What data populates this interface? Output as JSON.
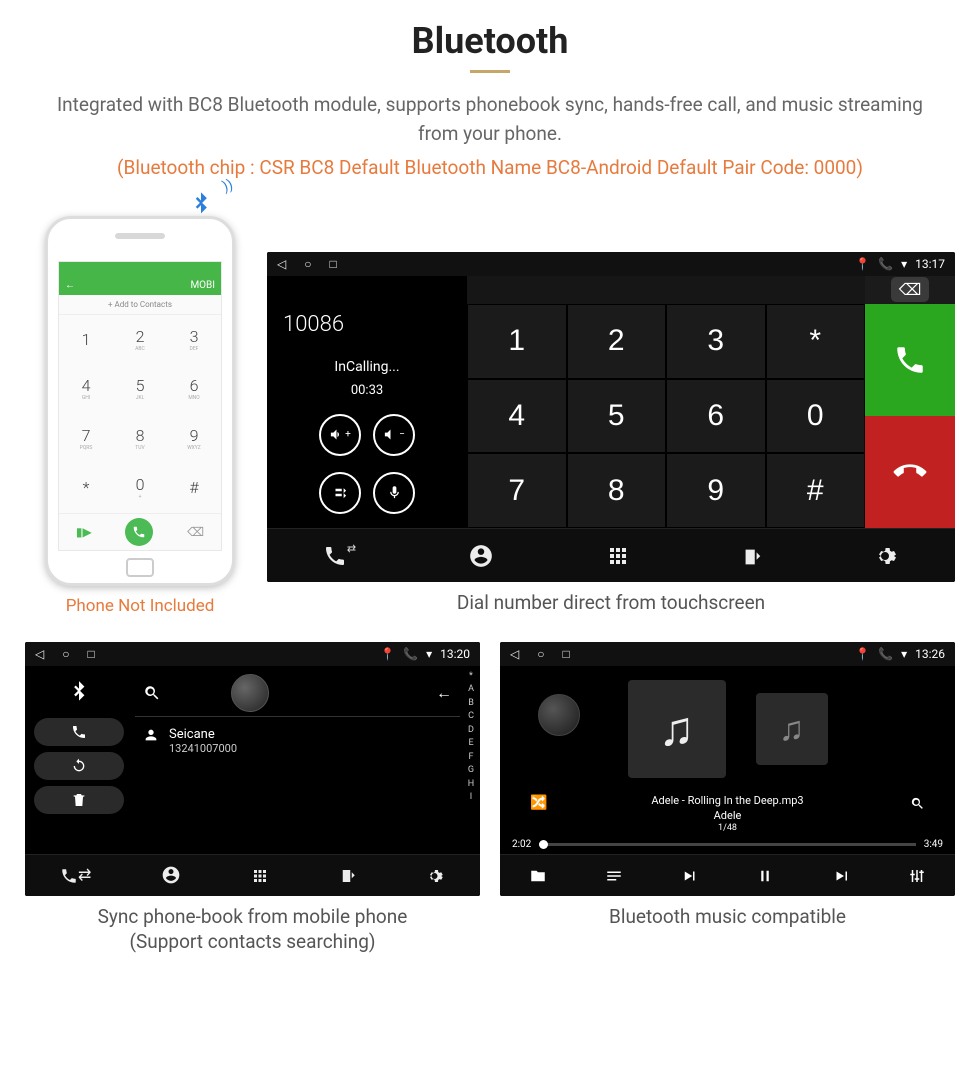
{
  "header": {
    "title": "Bluetooth",
    "description": "Integrated with BC8 Bluetooth module, supports phonebook sync, hands-free call, and music streaming from your phone.",
    "spec": "(Bluetooth chip : CSR BC8    Default Bluetooth Name BC8-Android    Default Pair Code: 0000)"
  },
  "phone": {
    "header_text": "MOBI",
    "add_contacts": "+  Add to Contacts",
    "caption": "Phone Not Included",
    "keys": [
      {
        "n": "1",
        "l": ""
      },
      {
        "n": "2",
        "l": "ABC"
      },
      {
        "n": "3",
        "l": "DEF"
      },
      {
        "n": "4",
        "l": "GHI"
      },
      {
        "n": "5",
        "l": "JKL"
      },
      {
        "n": "6",
        "l": "MNO"
      },
      {
        "n": "7",
        "l": "PQRS"
      },
      {
        "n": "8",
        "l": "TUV"
      },
      {
        "n": "9",
        "l": "WXYZ"
      },
      {
        "n": "*",
        "l": ""
      },
      {
        "n": "0",
        "l": "+"
      },
      {
        "n": "#",
        "l": ""
      }
    ]
  },
  "dialer": {
    "status_time": "13:17",
    "number": "10086",
    "status": "InCalling...",
    "duration": "00:33",
    "keys": [
      "1",
      "2",
      "3",
      "*",
      "4",
      "5",
      "6",
      "0",
      "7",
      "8",
      "9",
      "#"
    ],
    "caption": "Dial number direct from touchscreen"
  },
  "phonebook": {
    "status_time": "13:20",
    "contact_name": "Seicane",
    "contact_number": "13241007000",
    "index": [
      "*",
      "A",
      "B",
      "C",
      "D",
      "E",
      "F",
      "G",
      "H",
      "I"
    ],
    "caption_l1": "Sync phone-book from mobile phone",
    "caption_l2": "(Support contacts searching)"
  },
  "music": {
    "status_time": "13:26",
    "track": "Adele - Rolling In the Deep.mp3",
    "artist": "Adele",
    "position": "1/48",
    "time_cur": "2:02",
    "time_end": "3:49",
    "caption": "Bluetooth music compatible"
  }
}
